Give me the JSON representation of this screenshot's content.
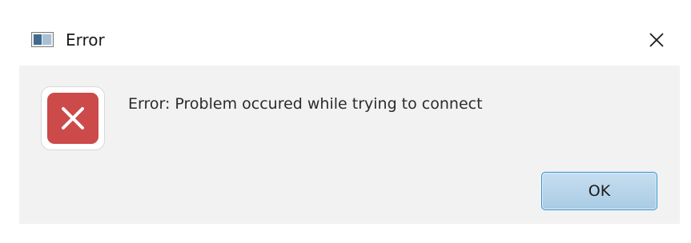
{
  "window": {
    "title": "Error",
    "app_icon": "window-app-icon",
    "close_icon": "close-icon"
  },
  "dialog": {
    "icon": "error-x-icon",
    "icon_color": "#cc4a4a",
    "message": "Error: Problem occured while trying to connect",
    "ok_label": "OK",
    "ok_accent": "#2d8fcf"
  }
}
